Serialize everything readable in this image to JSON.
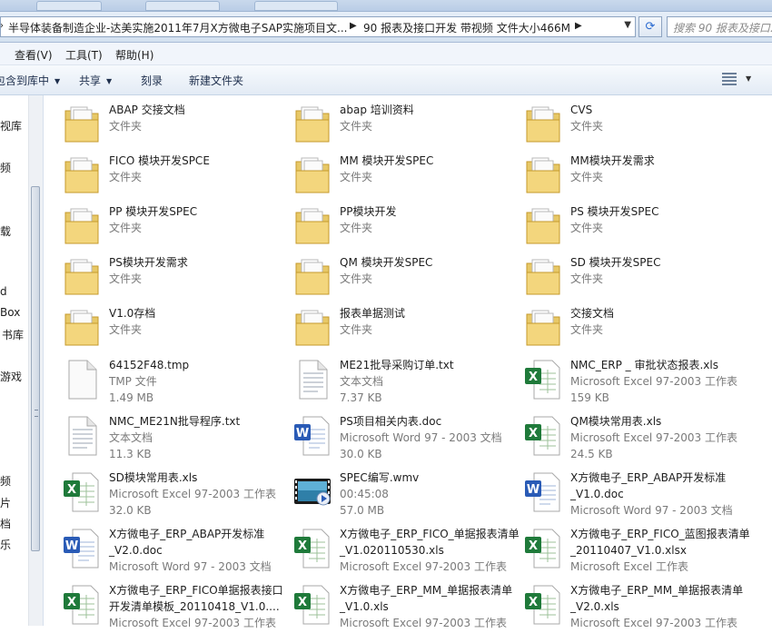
{
  "address": {
    "crumbs": [
      "半导体装备制造企业-达美实施2011年7月X方微电子SAP实施项目文...",
      "90 报表及接口开发 带视频 文件大小466M"
    ],
    "search_placeholder": "搜索 90 报表及接口..."
  },
  "menu": [
    "查看(V)",
    "工具(T)",
    "帮助(H)"
  ],
  "toolbar": {
    "include": "包含到库中",
    "share": "共享",
    "burn": "刻录",
    "new_folder": "新建文件夹"
  },
  "nav": [
    "视库",
    "频",
    "载",
    "d",
    "Box",
    "书库",
    "游戏",
    "频",
    "片",
    "档",
    "乐"
  ],
  "items": [
    {
      "name": "ABAP 交接文档",
      "meta": [
        "文件夹"
      ],
      "icon": "folder-icon"
    },
    {
      "name": "abap 培训资料",
      "meta": [
        "文件夹"
      ],
      "icon": "folder-icon"
    },
    {
      "name": "CVS",
      "meta": [
        "文件夹"
      ],
      "icon": "folder-icon"
    },
    {
      "name": "FICO 模块开发SPCE",
      "meta": [
        "文件夹"
      ],
      "icon": "folder-icon"
    },
    {
      "name": "MM 模块开发SPEC",
      "meta": [
        "文件夹"
      ],
      "icon": "folder-icon"
    },
    {
      "name": "MM模块开发需求",
      "meta": [
        "文件夹"
      ],
      "icon": "folder-icon"
    },
    {
      "name": "PP 模块开发SPEC",
      "meta": [
        "文件夹"
      ],
      "icon": "folder-icon"
    },
    {
      "name": "PP模块开发",
      "meta": [
        "文件夹"
      ],
      "icon": "folder-icon"
    },
    {
      "name": "PS 模块开发SPEC",
      "meta": [
        "文件夹"
      ],
      "icon": "folder-icon"
    },
    {
      "name": "PS模块开发需求",
      "meta": [
        "文件夹"
      ],
      "icon": "folder-icon"
    },
    {
      "name": "QM 模块开发SPEC",
      "meta": [
        "文件夹"
      ],
      "icon": "folder-icon"
    },
    {
      "name": "SD 模块开发SPEC",
      "meta": [
        "文件夹"
      ],
      "icon": "folder-icon"
    },
    {
      "name": "V1.0存档",
      "meta": [
        "文件夹"
      ],
      "icon": "folder-icon"
    },
    {
      "name": "报表单据测试",
      "meta": [
        "文件夹"
      ],
      "icon": "folder-icon"
    },
    {
      "name": "交接文档",
      "meta": [
        "文件夹"
      ],
      "icon": "folder-icon"
    },
    {
      "name": "64152F48.tmp",
      "meta": [
        "TMP 文件",
        "1.49 MB"
      ],
      "icon": "blank-file-icon"
    },
    {
      "name": "ME21批导采购订单.txt",
      "meta": [
        "文本文档",
        "7.37 KB"
      ],
      "icon": "text-file-icon"
    },
    {
      "name": "NMC_ERP _ 审批状态报表.xls",
      "meta": [
        "Microsoft Excel 97-2003 工作表",
        "159 KB"
      ],
      "icon": "excel-file-icon"
    },
    {
      "name": "NMC_ME21N批导程序.txt",
      "meta": [
        "文本文档",
        "11.3 KB"
      ],
      "icon": "text-file-icon"
    },
    {
      "name": "PS项目相关内表.doc",
      "meta": [
        "Microsoft Word 97 - 2003 文档",
        "30.0 KB"
      ],
      "icon": "word-file-icon"
    },
    {
      "name": "QM模块常用表.xls",
      "meta": [
        "Microsoft Excel 97-2003 工作表",
        "24.5 KB"
      ],
      "icon": "excel-file-icon"
    },
    {
      "name": "SD模块常用表.xls",
      "meta": [
        "Microsoft Excel 97-2003 工作表",
        "32.0 KB"
      ],
      "icon": "excel-file-icon"
    },
    {
      "name": "SPEC编写.wmv",
      "meta": [
        "00:45:08",
        "57.0 MB"
      ],
      "icon": "video-file-icon"
    },
    {
      "name": "X方微电子_ERP_ABAP开发标准_V1.0.doc",
      "meta": [
        "Microsoft Word 97 - 2003 文档"
      ],
      "icon": "word-file-icon"
    },
    {
      "name": "X方微电子_ERP_ABAP开发标准_V2.0.doc",
      "meta": [
        "Microsoft Word 97 - 2003 文档"
      ],
      "icon": "word-file-icon"
    },
    {
      "name": "X方微电子_ERP_FICO_单据报表清单_V1.020110530.xls",
      "meta": [
        "Microsoft Excel 97-2003 工作表"
      ],
      "icon": "excel-file-icon"
    },
    {
      "name": "X方微电子_ERP_FICO_蓝图报表清单_20110407_V1.0.xlsx",
      "meta": [
        "Microsoft Excel 工作表"
      ],
      "icon": "excel-file-icon"
    },
    {
      "name": "X方微电子_ERP_FICO单据报表接口开发清单模板_20110418_V1.0....",
      "meta": [
        "Microsoft Excel 97-2003 工作表"
      ],
      "icon": "excel-file-icon"
    },
    {
      "name": "X方微电子_ERP_MM_单据报表清单_V1.0.xls",
      "meta": [
        "Microsoft Excel 97-2003 工作表"
      ],
      "icon": "excel-file-icon"
    },
    {
      "name": "X方微电子_ERP_MM_单据报表清单_V2.0.xls",
      "meta": [
        "Microsoft Excel 97-2003 工作表"
      ],
      "icon": "excel-file-icon"
    }
  ]
}
